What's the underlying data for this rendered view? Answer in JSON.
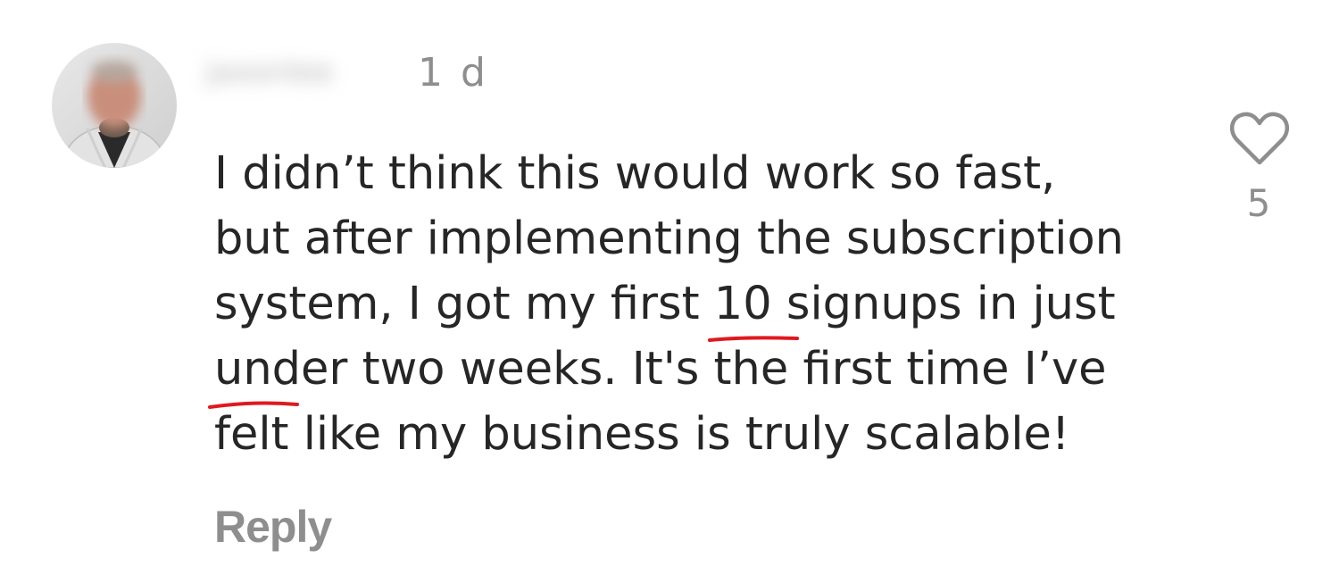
{
  "comment": {
    "username": "jaxonlee",
    "timestamp": "1 d",
    "text": {
      "line1": "I didn’t think this would work so fast,",
      "line2": "but after implementing the subscription",
      "line3_pre": "system, I got my first ",
      "line3_highlight": "10 signups",
      "line3_post": " in just",
      "line4_highlight": "under two weeks.",
      "line4_post": " It's the first time I’ve",
      "line5": "felt like my business is truly scalable!"
    },
    "reply_label": "Reply",
    "like_count": "5"
  },
  "colors": {
    "text": "#262626",
    "secondary": "#8e8e8e",
    "underline": "#e0191f"
  },
  "icons": {
    "avatar": "profile-photo-avatar",
    "like": "heart-outline-icon"
  }
}
